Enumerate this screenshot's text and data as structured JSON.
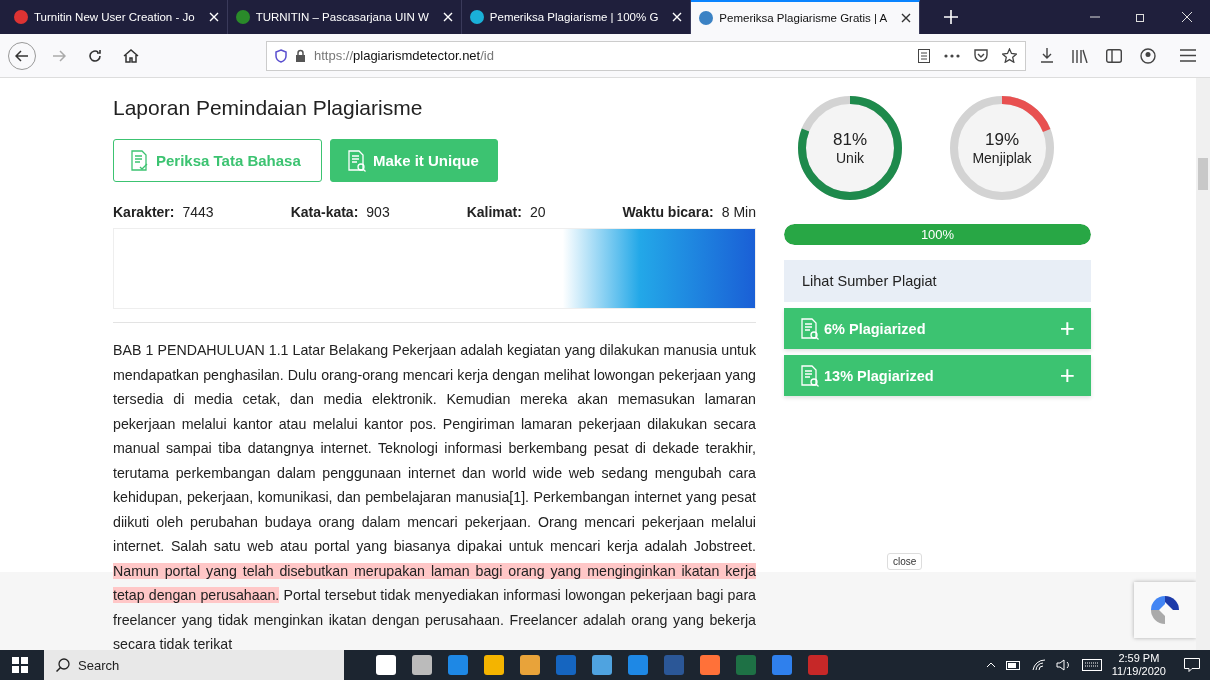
{
  "browser": {
    "tabs": [
      {
        "title": "Turnitin New User Creation - Jo",
        "selected": false
      },
      {
        "title": "TURNITIN – Pascasarjana UIN W",
        "selected": false
      },
      {
        "title": "Pemeriksa Plagiarisme | 100% G",
        "selected": false
      },
      {
        "title": "Pemeriksa Plagiarisme Gratis | A",
        "selected": true
      }
    ],
    "url_scheme": "https://",
    "url_host": "plagiarismdetector.net",
    "url_path": "/id"
  },
  "report": {
    "title": "Laporan Pemindaian Plagiarisme",
    "buttons": [
      {
        "label": "Periksa Tata Bahasa",
        "kind": "outline"
      },
      {
        "label": "Make it Unique",
        "kind": "filled"
      }
    ],
    "stats": [
      {
        "label": "Karakter:",
        "value": "7443"
      },
      {
        "label": "Kata-kata:",
        "value": "903"
      },
      {
        "label": "Kalimat:",
        "value": "20"
      },
      {
        "label": "Waktu bicara:",
        "value": "8 Min"
      }
    ],
    "text": [
      {
        "text": "BAB 1 PENDAHULUAN 1.1 Latar Belakang Pekerjaan adalah kegiatan yang dilakukan manusia untuk mendapatkan penghasilan. Dulu orang-orang mencari kerja dengan melihat lowongan pekerjaan yang tersedia di media cetak, dan media elektronik. Kemudian mereka akan memasukan lamaran pekerjaan melalui kantor atau melalui kantor pos. Pengiriman lamaran pekerjaan dilakukan secara manual sampai tiba datangnya internet. Teknologi informasi berkembang pesat di dekade terakhir, terutama perkembangan dalam penggunaan internet dan world wide web sedang mengubah cara kehidupan, pekerjaan, komunikasi, dan pembelajaran manusia[1]. Perkembangan internet yang pesat diikuti oleh perubahan budaya orang dalam mencari pekerjaan. Orang mencari pekerjaan melalui internet. Salah satu web atau portal yang biasanya dipakai untuk mencari kerja adalah Jobstreet. ",
        "highlighted": false
      },
      {
        "text": "Namun portal yang telah disebutkan merupakan laman bagi orang yang menginginkan ikatan kerja tetap dengan perusahaan.",
        "highlighted": true
      },
      {
        "text": " Portal tersebut tidak menyediakan informasi lowongan pekerjaan bagi para freelancer yang tidak menginkan ikatan dengan perusahaan. Freelancer adalah orang yang bekerja secara tidak terikat",
        "highlighted": false
      }
    ]
  },
  "results": {
    "gauges": [
      {
        "value": "81%",
        "label": "Unik",
        "level": 0.81,
        "color": "#1e8a4c"
      },
      {
        "value": "19%",
        "label": "Menjiplak",
        "level": 0.19,
        "color": "#e85050"
      }
    ],
    "progress": {
      "level": 1,
      "reading": "100%"
    },
    "sources_title": "Lihat Sumber Plagiat",
    "sources": [
      {
        "label": "6% Plagiarized",
        "toggle": "+"
      },
      {
        "label": "13% Plagiarized",
        "toggle": "+"
      }
    ]
  },
  "overlay": {
    "close": "close"
  },
  "taskbar": {
    "search": "Search",
    "time": "2:59 PM",
    "date": "11/19/2020"
  }
}
